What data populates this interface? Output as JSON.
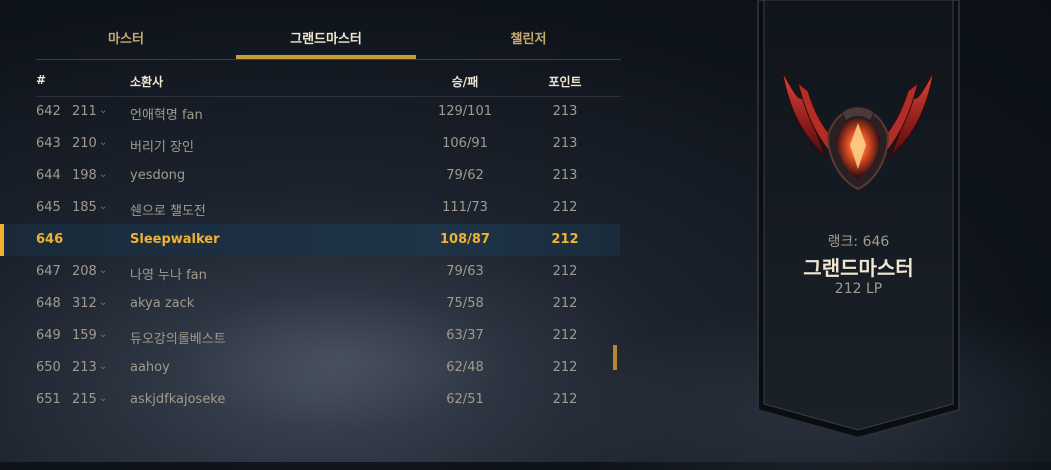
{
  "tabs": [
    {
      "label": "마스터",
      "active": false
    },
    {
      "label": "그랜드마스터",
      "active": true
    },
    {
      "label": "챌린저",
      "active": false
    }
  ],
  "columns": {
    "rank": "#",
    "summoner": "소환사",
    "winloss": "승/패",
    "points": "포인트"
  },
  "rows": [
    {
      "rank": "642",
      "prev": "211",
      "name": "언애혁명 fan",
      "wl": "129/101",
      "points": "213",
      "highlight": false
    },
    {
      "rank": "643",
      "prev": "210",
      "name": "버리기 장인",
      "wl": "106/91",
      "points": "213",
      "highlight": false
    },
    {
      "rank": "644",
      "prev": "198",
      "name": "yesdong",
      "wl": "79/62",
      "points": "213",
      "highlight": false
    },
    {
      "rank": "645",
      "prev": "185",
      "name": "쉔으로 챌도전",
      "wl": "111/73",
      "points": "212",
      "highlight": false
    },
    {
      "rank": "646",
      "prev": "",
      "name": "Sleepwalker",
      "wl": "108/87",
      "points": "212",
      "highlight": true
    },
    {
      "rank": "647",
      "prev": "208",
      "name": "나영 누나 fan",
      "wl": "79/63",
      "points": "212",
      "highlight": false
    },
    {
      "rank": "648",
      "prev": "312",
      "name": "akya zack",
      "wl": "75/58",
      "points": "212",
      "highlight": false
    },
    {
      "rank": "649",
      "prev": "159",
      "name": "듀오강의롤베스트",
      "wl": "63/37",
      "points": "212",
      "highlight": false
    },
    {
      "rank": "650",
      "prev": "213",
      "name": "aahoy",
      "wl": "62/48",
      "points": "212",
      "highlight": false
    },
    {
      "rank": "651",
      "prev": "215",
      "name": "askjdfkajoseke",
      "wl": "62/51",
      "points": "212",
      "highlight": false
    }
  ],
  "profile": {
    "rank_label": "랭크: 646",
    "tier": "그랜드마스터",
    "lp": "212 LP",
    "emblem": "grandmaster-emblem-icon"
  },
  "colors": {
    "accent": "#c89b3c",
    "highlight_text": "#f0b232",
    "emblem_red": "#c0302a"
  }
}
